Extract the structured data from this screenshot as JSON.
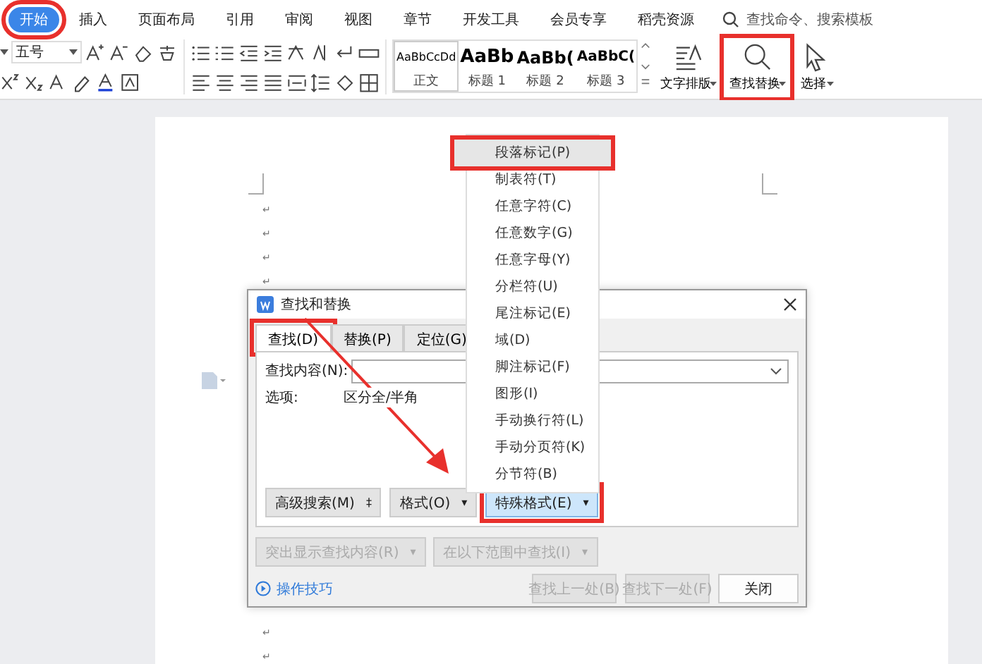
{
  "menu_tabs": [
    {
      "label": "开始",
      "selected": true,
      "annotated": true
    },
    {
      "label": "插入",
      "selected": false,
      "annotated": false
    },
    {
      "label": "页面布局",
      "selected": false,
      "annotated": false
    },
    {
      "label": "引用",
      "selected": false,
      "annotated": false
    },
    {
      "label": "审阅",
      "selected": false,
      "annotated": false
    },
    {
      "label": "视图",
      "selected": false,
      "annotated": false
    },
    {
      "label": "章节",
      "selected": false,
      "annotated": false
    },
    {
      "label": "开发工具",
      "selected": false,
      "annotated": false
    },
    {
      "label": "会员专享",
      "selected": false,
      "annotated": false
    },
    {
      "label": "稻壳资源",
      "selected": false,
      "annotated": false
    }
  ],
  "search": {
    "placeholder": "查找命令、搜索模板"
  },
  "ribbon": {
    "font_size": "五号",
    "styles": [
      {
        "preview": "AaBbCcDd",
        "label": "正文",
        "kind": "normal"
      },
      {
        "preview": "AaBb",
        "label": "标题 1",
        "kind": "h1"
      },
      {
        "preview": "AaBb(",
        "label": "标题 2",
        "kind": "h2"
      },
      {
        "preview": "AaBbC(",
        "label": "标题 3",
        "kind": "h3"
      }
    ],
    "tools": [
      {
        "label": "文字排版",
        "kind": "layout",
        "annotated": false
      },
      {
        "label": "查找替换",
        "kind": "find",
        "annotated": true
      },
      {
        "label": "选择",
        "kind": "select",
        "annotated": false
      }
    ]
  },
  "document": {
    "marks_top": [
      "↵",
      "↵",
      "↵",
      "↵"
    ],
    "marks_bottom": [
      "↵",
      "↵"
    ]
  },
  "dialog": {
    "title": "查找和替换",
    "tabs": [
      {
        "label": "查找(D)",
        "selected": true,
        "annotated": true
      },
      {
        "label": "替换(P)",
        "selected": false,
        "annotated": false
      },
      {
        "label": "定位(G)",
        "selected": false,
        "annotated": false
      }
    ],
    "find_label": "查找内容(N):",
    "options_label": "选项:",
    "options_value": "区分全/半角",
    "panel_buttons": [
      {
        "label": "高级搜索(M)",
        "caret": "‡",
        "selected": false,
        "annotated": false
      },
      {
        "label": "格式(O)",
        "caret": "▾",
        "selected": false,
        "annotated": false
      },
      {
        "label": "特殊格式(E)",
        "caret": "▾",
        "selected": true,
        "annotated": true
      }
    ],
    "range_buttons": [
      {
        "label": "突出显示查找内容(R)",
        "caret": "▾",
        "disabled": true
      },
      {
        "label": "在以下范围中查找(I)",
        "caret": "▾",
        "disabled": true
      }
    ],
    "tips_link": "操作技巧",
    "bottom_buttons": [
      {
        "label": "查找上一处(B)",
        "disabled": true
      },
      {
        "label": "查找下一处(F)",
        "disabled": true
      },
      {
        "label": "关闭",
        "disabled": false
      }
    ]
  },
  "special_menu": [
    {
      "label": "段落标记(P)",
      "selected": true,
      "annotated": true
    },
    {
      "label": "制表符(T)",
      "selected": false,
      "annotated": false
    },
    {
      "label": "任意字符(C)",
      "selected": false,
      "annotated": false
    },
    {
      "label": "任意数字(G)",
      "selected": false,
      "annotated": false
    },
    {
      "label": "任意字母(Y)",
      "selected": false,
      "annotated": false
    },
    {
      "label": "分栏符(U)",
      "selected": false,
      "annotated": false
    },
    {
      "label": "尾注标记(E)",
      "selected": false,
      "annotated": false
    },
    {
      "label": "域(D)",
      "selected": false,
      "annotated": false
    },
    {
      "label": "脚注标记(F)",
      "selected": false,
      "annotated": false
    },
    {
      "label": "图形(I)",
      "selected": false,
      "annotated": false
    },
    {
      "label": "手动换行符(L)",
      "selected": false,
      "annotated": false
    },
    {
      "label": "手动分页符(K)",
      "selected": false,
      "annotated": false
    },
    {
      "label": "分节符(B)",
      "selected": false,
      "annotated": false
    }
  ]
}
